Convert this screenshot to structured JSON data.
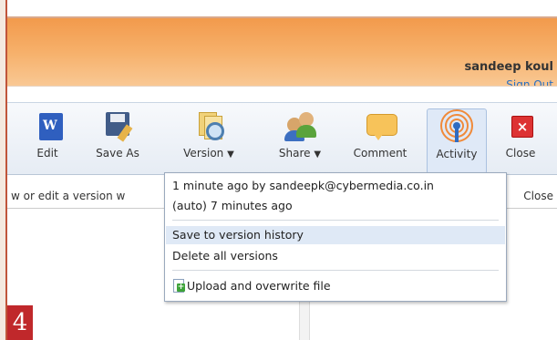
{
  "header": {
    "user_name": "sandeep koul",
    "sign_out": "Sign Out"
  },
  "ribbon": {
    "edit": "Edit",
    "save_as": "Save As",
    "version": "Version",
    "share": "Share",
    "comment": "Comment",
    "activity": "Activity",
    "close": "Close",
    "dropdown_arrow": "▼"
  },
  "infobar": {
    "text": "w or edit a version w",
    "close": "Close"
  },
  "version_menu": {
    "line1": "1 minute ago by sandeepk@cybermedia.co.in",
    "line2": "(auto) 7 minutes ago",
    "save_history": "Save to version history",
    "delete_all": "Delete all versions",
    "upload_overwrite": "Upload and overwrite file"
  },
  "badge": "4",
  "colors": {
    "header": "#f29a4c",
    "link": "#2a6fc1",
    "badge": "#c0282b"
  }
}
